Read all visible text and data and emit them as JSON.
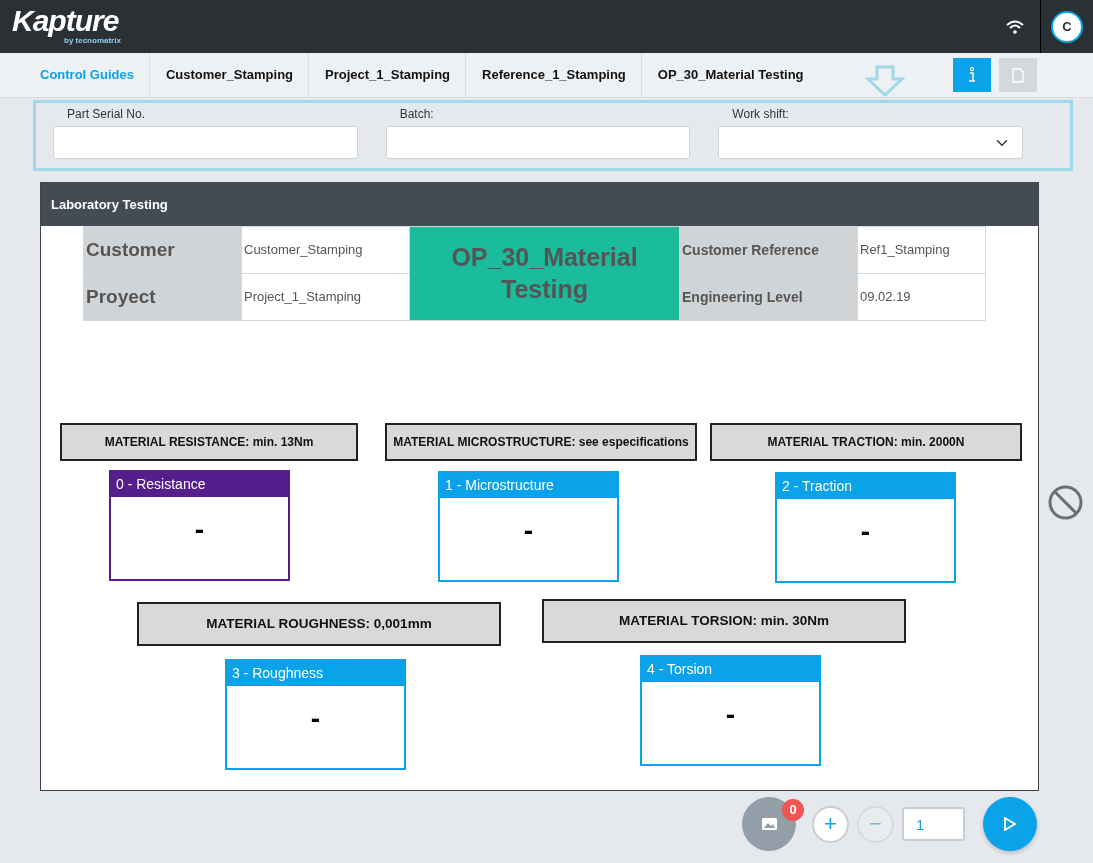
{
  "app": {
    "logo": "Kapture",
    "logo_sub": "by tecnomatrix",
    "user_initial": "C"
  },
  "breadcrumb": [
    {
      "label": "Control Guides",
      "link": true
    },
    {
      "label": "Customer_Stamping",
      "link": false
    },
    {
      "label": "Project_1_Stamping",
      "link": false
    },
    {
      "label": "Reference_1_Stamping",
      "link": false
    },
    {
      "label": "OP_30_Material Testing",
      "link": false
    }
  ],
  "toolbar": {
    "info_active": true,
    "document_disabled": true
  },
  "form": [
    {
      "label": "Part Serial No.",
      "kind": "text"
    },
    {
      "label": "Batch:",
      "kind": "text"
    },
    {
      "label": "Work shift:",
      "kind": "select"
    }
  ],
  "panel": {
    "title": "Laboratory Testing",
    "info": {
      "rows": [
        {
          "label": "Customer",
          "value": "Customer_Stamping",
          "label2": "Customer Reference",
          "value2": "Ref1_Stamping"
        },
        {
          "label": "Proyect",
          "value": "Project_1_Stamping",
          "label2": "Engineering Level",
          "value2": "09.02.19"
        }
      ],
      "operation": "OP_30_Material Testing"
    },
    "requirements": [
      "MATERIAL RESISTANCE: min. 13Nm",
      "MATERIAL MICROSTRUCTURE: see especifications",
      "MATERIAL TRACTION: min. 2000N",
      "MATERIAL ROUGHNESS: 0,001mm",
      "MATERIAL TORSION: min. 30Nm"
    ],
    "tests": [
      {
        "title": "0 - Resistance",
        "value": "-",
        "color": "#561d8c"
      },
      {
        "title": "1 - Microstructure",
        "value": "-",
        "color": "#0aa3ea"
      },
      {
        "title": "2 - Traction",
        "value": "-",
        "color": "#0aa3ea"
      },
      {
        "title": "3 - Roughness",
        "value": "-",
        "color": "#0aa3ea"
      },
      {
        "title": "4 - Torsion",
        "value": "-",
        "color": "#0aa3ea"
      }
    ]
  },
  "footer": {
    "images_count": "0",
    "plus_label": "+",
    "minus_label": "−",
    "page": "1",
    "minus_disabled": true
  }
}
